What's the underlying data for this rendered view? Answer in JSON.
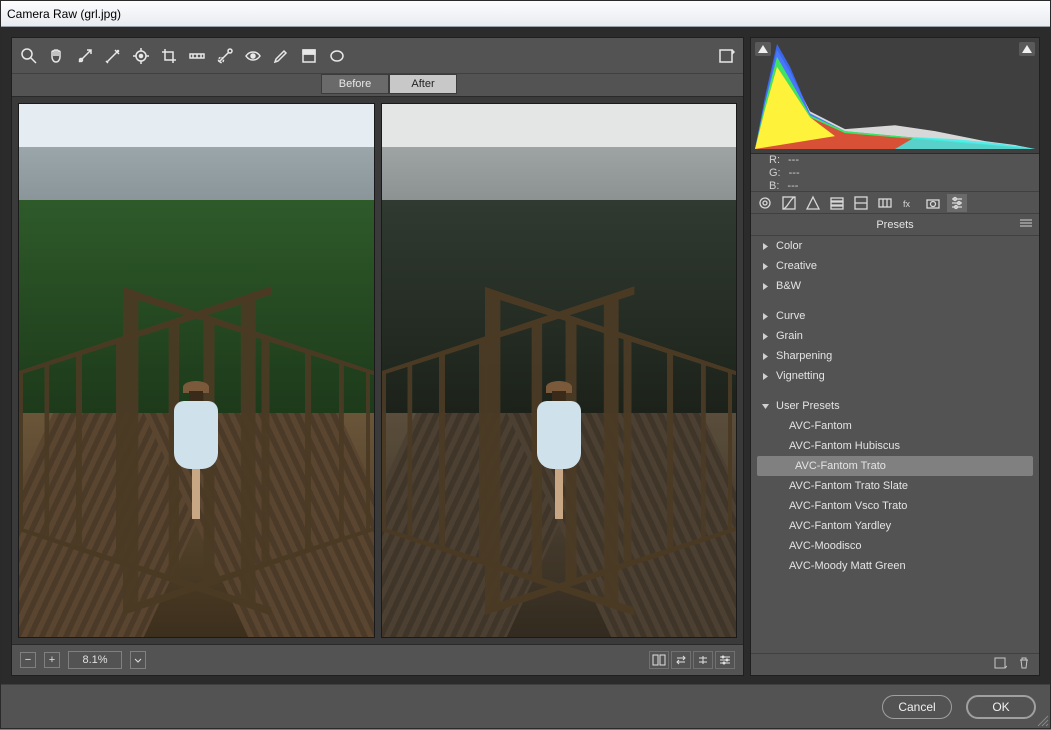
{
  "window": {
    "title": "Camera Raw (grl.jpg)"
  },
  "compare": {
    "before": "Before",
    "after": "After"
  },
  "zoom": {
    "value": "8.1%"
  },
  "rgb": {
    "r_label": "R:",
    "g_label": "G:",
    "b_label": "B:",
    "r": "---",
    "g": "---",
    "b": "---"
  },
  "panel": {
    "header": "Presets"
  },
  "categories": {
    "color": "Color",
    "creative": "Creative",
    "bw": "B&W",
    "curve": "Curve",
    "grain": "Grain",
    "sharpening": "Sharpening",
    "vignetting": "Vignetting",
    "user": "User Presets"
  },
  "presets": {
    "p0": "AVC-Fantom",
    "p1": "AVC-Fantom Hubiscus",
    "p2": "AVC-Fantom Trato",
    "p3": "AVC-Fantom Trato Slate",
    "p4": "AVC-Fantom Vsco Trato",
    "p5": "AVC-Fantom Yardley",
    "p6": "AVC-Moodisco",
    "p7": "AVC-Moody Matt Green"
  },
  "buttons": {
    "ok": "OK",
    "cancel": "Cancel"
  },
  "chart_data": {
    "type": "area",
    "title": "",
    "xlabel": "",
    "ylabel": "",
    "x_range": [
      0,
      255
    ],
    "y_range": [
      0,
      100
    ],
    "note": "RGB histogram; overlapping channel areas. Strong shadow peak near luminance 20-35, fast falloff, low plateau through midtones, slight cyan tail in highlights.",
    "series": [
      {
        "name": "Red",
        "color": "#ff2a2a",
        "x": [
          0,
          15,
          25,
          35,
          50,
          80,
          120,
          160,
          200,
          255
        ],
        "values": [
          10,
          40,
          78,
          55,
          30,
          18,
          20,
          15,
          5,
          0
        ]
      },
      {
        "name": "Green",
        "color": "#3cff3c",
        "x": [
          0,
          15,
          25,
          35,
          50,
          80,
          120,
          160,
          200,
          255
        ],
        "values": [
          8,
          45,
          90,
          60,
          28,
          16,
          18,
          14,
          6,
          0
        ]
      },
      {
        "name": "Blue",
        "color": "#3a6cff",
        "x": [
          0,
          15,
          25,
          35,
          50,
          80,
          120,
          160,
          200,
          255
        ],
        "values": [
          5,
          55,
          100,
          70,
          26,
          14,
          14,
          12,
          8,
          0
        ]
      },
      {
        "name": "Luminance",
        "color": "#d8d8d8",
        "x": [
          0,
          15,
          25,
          35,
          50,
          80,
          120,
          160,
          200,
          240,
          255
        ],
        "values": [
          6,
          48,
          95,
          64,
          28,
          16,
          17,
          13,
          8,
          4,
          0
        ]
      },
      {
        "name": "Yellow-overlap",
        "color": "#fff23a",
        "x": [
          0,
          15,
          25,
          35,
          50,
          80,
          255
        ],
        "values": [
          8,
          40,
          78,
          55,
          28,
          12,
          0
        ]
      },
      {
        "name": "Cyan-overlap",
        "color": "#3af0f0",
        "x": [
          120,
          160,
          200,
          240,
          255
        ],
        "values": [
          12,
          10,
          8,
          4,
          0
        ]
      }
    ]
  }
}
